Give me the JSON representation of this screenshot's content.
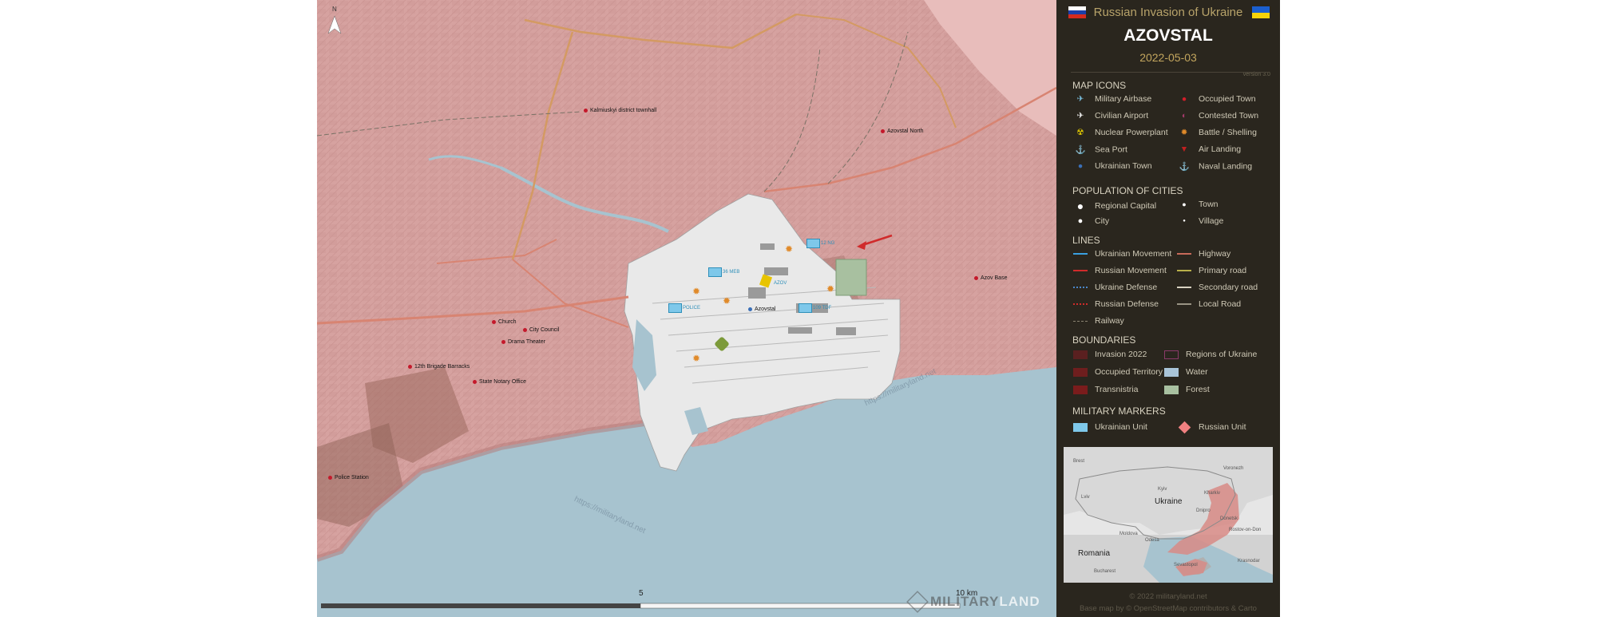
{
  "map": {
    "north": "N",
    "places": {
      "kalmiuskyi": "Kalmiuskyi district townhall",
      "azovstal_north": "Azovstal North",
      "azov_base": "Azov Base",
      "church": "Church",
      "city_council": "City Council",
      "drama_theater": "Drama Theater",
      "brigade_barracks": "12th Brigade Barracks",
      "notary_office": "State Notary Office",
      "police_station": "Police Station",
      "azovstal": "Azovstal"
    },
    "units": {
      "mech": "36 MEB",
      "ng": "12 NG",
      "azov": "AZOV",
      "police": "POLICE",
      "tdf": "109 TDF"
    },
    "scale": {
      "mid": "5",
      "end": "10 km"
    },
    "brand": {
      "part1": "MILITARY",
      "part2": "LAND"
    },
    "watermark": "https://militaryland.net"
  },
  "panel": {
    "title": "Russian Invasion of Ukraine",
    "subtitle": "AZOVSTAL",
    "date": "2022-05-03",
    "version": "version 3.0",
    "sections": {
      "map_icons": "MAP ICONS",
      "population": "POPULATION OF CITIES",
      "lines": "LINES",
      "boundaries": "BOUNDARIES",
      "markers": "MILITARY MARKERS"
    },
    "map_icons": [
      {
        "label": "Military Airbase",
        "icon": "military-airbase-icon"
      },
      {
        "label": "Occupied Town",
        "icon": "occupied-town-icon"
      },
      {
        "label": "Civilian Airport",
        "icon": "civilian-airport-icon"
      },
      {
        "label": "Contested Town",
        "icon": "contested-town-icon"
      },
      {
        "label": "Nuclear Powerplant",
        "icon": "nuclear-icon"
      },
      {
        "label": "Battle / Shelling",
        "icon": "fire-icon"
      },
      {
        "label": "Sea Port",
        "icon": "anchor-icon"
      },
      {
        "label": "Air Landing",
        "icon": "parachute-icon"
      },
      {
        "label": "Ukrainian Town",
        "icon": "ukrainian-town-icon"
      },
      {
        "label": "Naval Landing",
        "icon": "naval-anchor-icon"
      }
    ],
    "population": [
      {
        "label": "Regional Capital"
      },
      {
        "label": "Town"
      },
      {
        "label": "City"
      },
      {
        "label": "Village"
      }
    ],
    "lines": [
      {
        "label": "Ukrainian Movement",
        "color": "#3aa0e0"
      },
      {
        "label": "Highway",
        "color": "#c86a5a"
      },
      {
        "label": "Russian Movement",
        "color": "#d02b2b"
      },
      {
        "label": "Primary road",
        "color": "#b8b04a"
      },
      {
        "label": "Ukraine Defense",
        "color": "#4a86c8"
      },
      {
        "label": "Secondary road",
        "color": "#d8d2c0"
      },
      {
        "label": "Russian Defense",
        "color": "#d02b2b"
      },
      {
        "label": "Local Road",
        "color": "#9a9484"
      },
      {
        "label": "Railway",
        "color": "#8a8472"
      }
    ],
    "boundaries": [
      {
        "label": "Invasion 2022",
        "color": "#5a2020"
      },
      {
        "label": "Regions of Ukraine",
        "color": "#8a3a6a"
      },
      {
        "label": "Occupied Territory",
        "color": "#6e1e1e"
      },
      {
        "label": "Water",
        "color": "#a9c4d8"
      },
      {
        "label": "Transnistria",
        "color": "#7a1c1c"
      },
      {
        "label": "Forest",
        "color": "#a8c0a0"
      }
    ],
    "markers": [
      {
        "label": "Ukrainian Unit",
        "color": "#7ec8ea"
      },
      {
        "label": "Russian Unit",
        "color": "#f08080"
      }
    ],
    "inset": {
      "ukraine": "Ukraine",
      "romania": "Romania",
      "moldova": "Moldova",
      "kyiv": "Kyiv",
      "kharkiv": "Kharkiv",
      "dnipro": "Dnipro",
      "donetsk": "Donetsk",
      "rostov": "Rostov-on-Don",
      "krasnodar": "Krasnodar",
      "odesa": "Odesa",
      "lviv": "Lviv",
      "brest": "Brest",
      "voronezh": "Voronezh",
      "bucharest": "Bucharest",
      "sevastopol": "Sevastopol"
    },
    "copyright": "© 2022 militaryland.net",
    "basemap": "Base map by © OpenStreetMap contributors & Carto"
  },
  "colors": {
    "occupied": "#d6a2a0",
    "water": "#a7c3cf",
    "plant": "#e9e9e9",
    "panel_bg": "#2a261e",
    "accent": "#c3a65e"
  }
}
